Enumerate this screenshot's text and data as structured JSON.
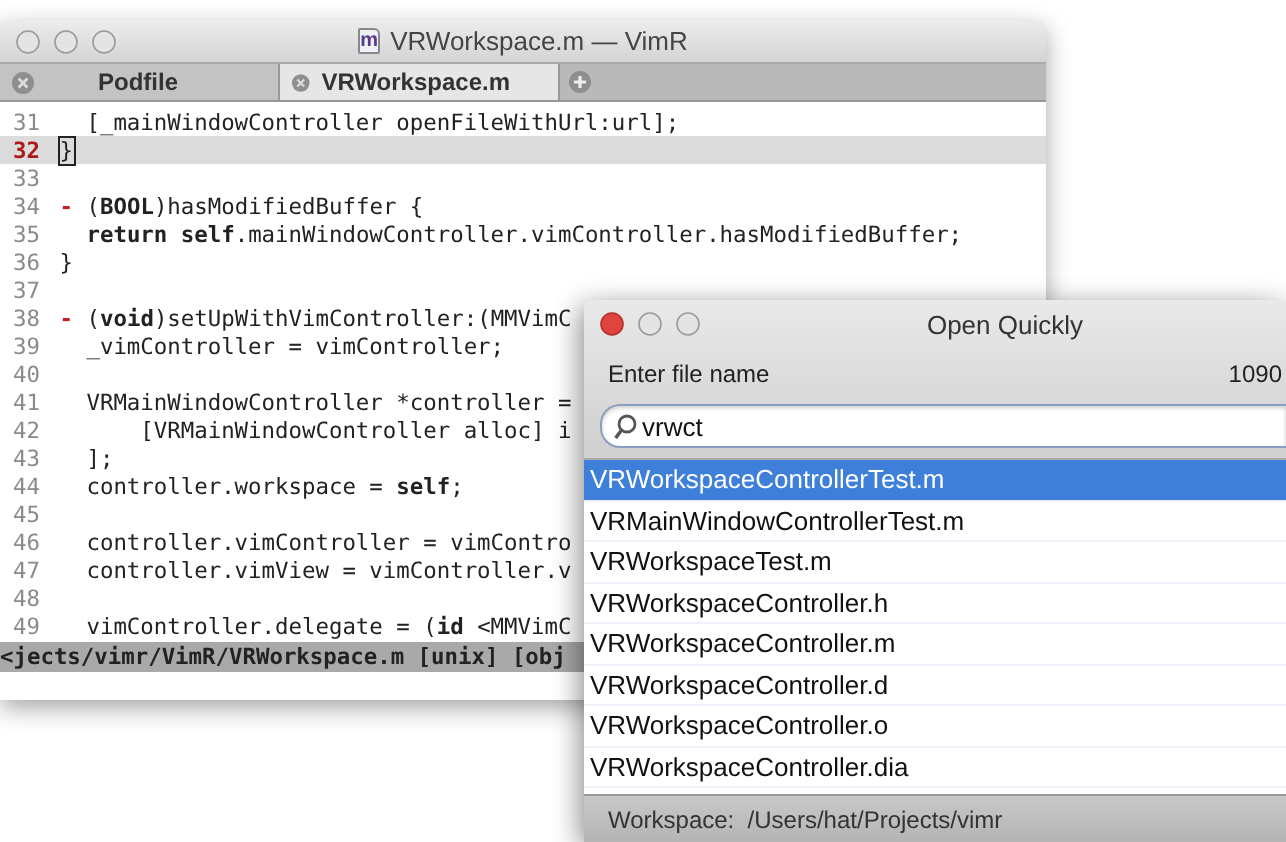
{
  "editor": {
    "title": "VRWorkspace.m — VimR",
    "file_icon": "m",
    "tabs": [
      {
        "label": "Podfile",
        "selected": false
      },
      {
        "label": "VRWorkspace.m",
        "selected": true
      }
    ],
    "lines": [
      {
        "num": "31",
        "text": "  [_mainWindowController openFileWithUrl:url];"
      },
      {
        "num": "32",
        "text": "}",
        "current": true
      },
      {
        "num": "33"
      },
      {
        "num": "34",
        "sign": "-",
        "text": " (**BOOL**)hasModifiedBuffer {"
      },
      {
        "num": "35",
        "text": "  **return self**.mainWindowController.vimController.hasModifiedBuffer;"
      },
      {
        "num": "36",
        "text": "}"
      },
      {
        "num": "37"
      },
      {
        "num": "38",
        "sign": "-",
        "text": " (**void**)setUpWithVimController:(MMVimC"
      },
      {
        "num": "39",
        "text": "  _vimController = vimController;"
      },
      {
        "num": "40"
      },
      {
        "num": "41",
        "text": "  VRMainWindowController *controller ="
      },
      {
        "num": "42",
        "text": "      [VRMainWindowController alloc] i"
      },
      {
        "num": "43",
        "text": "  ];"
      },
      {
        "num": "44",
        "text": "  controller.workspace = **self**;"
      },
      {
        "num": "45"
      },
      {
        "num": "46",
        "text": "  controller.vimController = vimContro"
      },
      {
        "num": "47",
        "text": "  controller.vimView = vimController.v"
      },
      {
        "num": "48"
      },
      {
        "num": "49",
        "text": "  vimController.delegate = (**id** <MMVimC"
      }
    ],
    "status_bar": "<jects/vimr/VimR/VRWorkspace.m [unix] [obj"
  },
  "open_quickly": {
    "title": "Open Quickly",
    "prompt": "Enter file name",
    "count": "1090",
    "search": {
      "value": "vrwct"
    },
    "results": [
      {
        "label": "VRWorkspaceControllerTest.m",
        "selected": true
      },
      {
        "label": "VRMainWindowControllerTest.m",
        "selected": false
      },
      {
        "label": "VRWorkspaceTest.m",
        "selected": false
      },
      {
        "label": "VRWorkspaceController.h",
        "selected": false
      },
      {
        "label": "VRWorkspaceController.m",
        "selected": false
      },
      {
        "label": "VRWorkspaceController.d",
        "selected": false
      },
      {
        "label": "VRWorkspaceController.o",
        "selected": false
      },
      {
        "label": "VRWorkspaceController.dia",
        "selected": false
      }
    ],
    "footer": "Workspace:  /Users/hat/Projects/vimr"
  }
}
